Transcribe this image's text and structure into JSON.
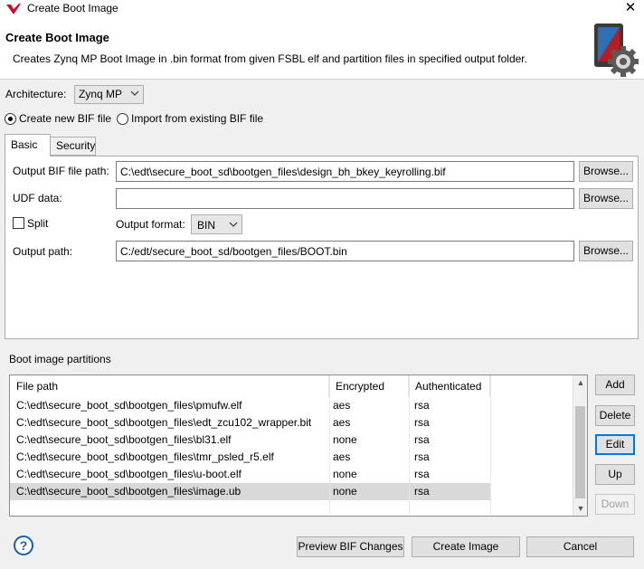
{
  "window": {
    "title": "Create Boot Image",
    "close_glyph": "✕"
  },
  "banner": {
    "title": "Create Boot Image",
    "description": "Creates Zynq MP Boot Image in .bin format from given FSBL elf and partition files in specified output folder."
  },
  "architecture": {
    "label": "Architecture:",
    "value": "Zynq MP"
  },
  "bif_mode": {
    "create_new_label": "Create new BIF file",
    "import_label": "Import from existing BIF file",
    "selected": "create_new"
  },
  "tabs": [
    {
      "label": "Basic",
      "active": true
    },
    {
      "label": "Security",
      "active": false
    }
  ],
  "basic": {
    "output_bif_label": "Output BIF file path:",
    "output_bif_value": "C:\\edt\\secure_boot_sd\\bootgen_files\\design_bh_bkey_keyrolling.bif",
    "udf_label": "UDF data:",
    "udf_value": "",
    "split_label": "Split",
    "split_checked": false,
    "output_format_label": "Output format:",
    "output_format_value": "BIN",
    "output_path_label": "Output path:",
    "output_path_value": "C:/edt/secure_boot_sd/bootgen_files/BOOT.bin",
    "browse_label": "Browse..."
  },
  "partitions": {
    "label": "Boot image partitions",
    "columns": [
      "File path",
      "Encrypted",
      "Authenticated"
    ],
    "rows": [
      {
        "path": "C:\\edt\\secure_boot_sd\\bootgen_files\\pmufw.elf",
        "encrypted": "aes",
        "authenticated": "rsa"
      },
      {
        "path": "C:\\edt\\secure_boot_sd\\bootgen_files\\edt_zcu102_wrapper.bit",
        "encrypted": "aes",
        "authenticated": "rsa"
      },
      {
        "path": "C:\\edt\\secure_boot_sd\\bootgen_files\\bl31.elf",
        "encrypted": "none",
        "authenticated": "rsa"
      },
      {
        "path": "C:\\edt\\secure_boot_sd\\bootgen_files\\tmr_psled_r5.elf",
        "encrypted": "aes",
        "authenticated": "rsa"
      },
      {
        "path": "C:\\edt\\secure_boot_sd\\bootgen_files\\u-boot.elf",
        "encrypted": "none",
        "authenticated": "rsa"
      },
      {
        "path": "C:\\edt\\secure_boot_sd\\bootgen_files\\image.ub",
        "encrypted": "none",
        "authenticated": "rsa"
      }
    ],
    "selected_row": 5,
    "buttons": {
      "add": "Add",
      "delete": "Delete",
      "edit": "Edit",
      "up": "Up",
      "down": "Down"
    }
  },
  "footer": {
    "help_glyph": "?",
    "preview_label": "Preview BIF Changes",
    "create_label": "Create Image",
    "cancel_label": "Cancel"
  },
  "icons": {
    "app": "xilinx-logo-icon",
    "banner": "boot-image-gear-icon",
    "help": "help-icon"
  },
  "colors": {
    "accent": "#0078d7",
    "help": "#1a5fa8",
    "logo": "#c8102e"
  }
}
